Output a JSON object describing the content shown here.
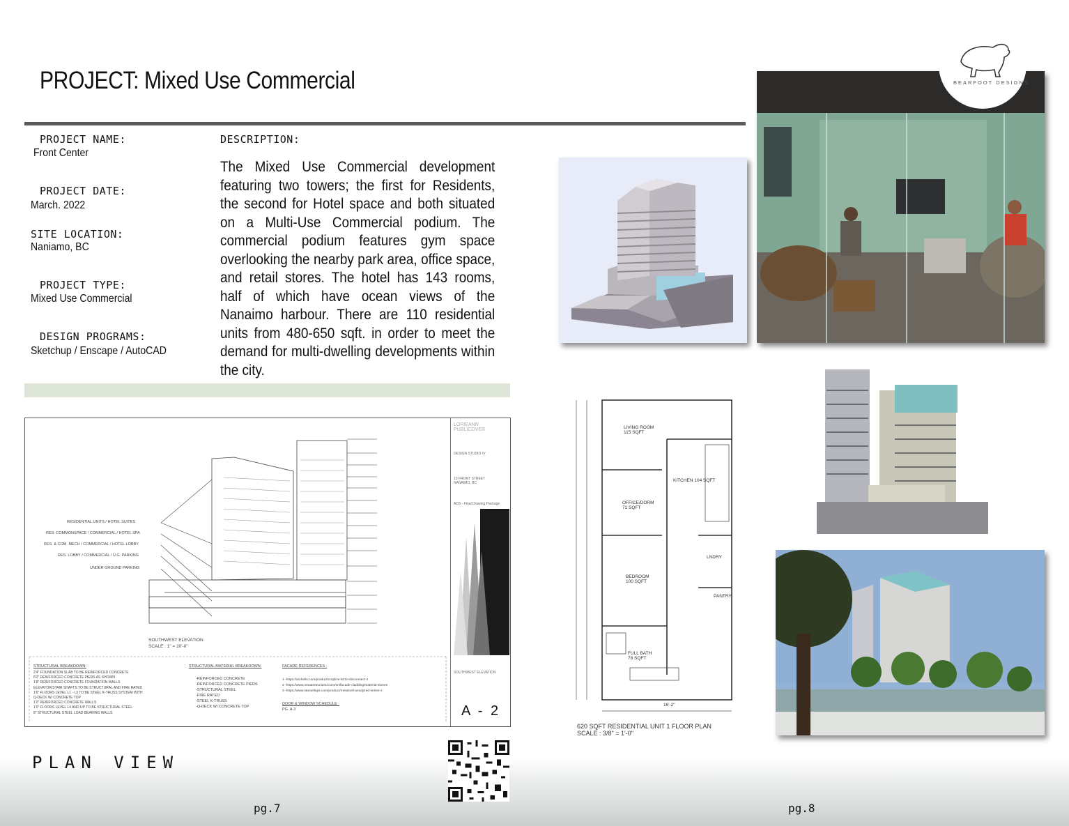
{
  "header": {
    "title": "PROJECT: Mixed Use Commercial"
  },
  "info": {
    "project_name_label": "PROJECT NAME:",
    "project_name": "Front Center",
    "project_date_label": "PROJECT DATE:",
    "project_date": "March. 2022",
    "site_location_label": "SITE LOCATION:",
    "site_location": "Naniamo, BC",
    "project_type_label": "PROJECT TYPE:",
    "project_type": "Mixed Use Commercial",
    "design_programs_label": "DESIGN PROGRAMS:",
    "design_programs": "Sketchup / Enscape / AutoCAD"
  },
  "description": {
    "label": "DESCRIPTION:",
    "text": "The Mixed Use Commercial development featuring two towers; the first for Residents, the second for Hotel space and both situated on a Multi-Use Commercial podium. The commercial podium features gym space overlooking the nearby park area, office space, and retail stores. The hotel has 143 rooms, half of which have ocean views of the Nanaimo harbour. There are 110 residential units from 480-650 sqft. in order to meet the demand for multi-dwelling developments within the city."
  },
  "logo": {
    "text": "BEARFOOT DESIGNS"
  },
  "drawing_sheet": {
    "sheet_id": "A - 2",
    "elevation_title": "SOUTHWEST ELEVATION",
    "elevation_scale": "SCALE : 1\" = 20'-0\"",
    "callouts": [
      "RESIDENTIAL UNITS / HOTEL SUITES",
      "RES. COMMONSPACE / COMMERCIAL / HOTEL SPA",
      "RES. & COM. MECH / COMMERCIAL / HOTEL LOBBY",
      "RES. LOBBY / COMMERCIAL / U.G. PARKING",
      "UNDER GROUND PARKING"
    ],
    "title_block": {
      "name": "LORIEANN PUBLICOVER",
      "project": "DESIGN STUDIO IV",
      "address": "10 FRONT STREET NANAIMO, BC",
      "package": "ADS - Final Drawing Package",
      "drawing": "SOUTHWEST ELEVATION"
    },
    "notes": {
      "structural_heading": "STRUCTURAL BREAKDOWN:",
      "structural": "2'4\" FOUNDATION SLAB TO BE REINFORCED CONCRETE\n8'2\" REINFORCED CONCRETE PIERS AS SHOWN\n1'8\" REINFORCED CONCRETE FOUNDATION WALLS\nELEVATOR/STAIR SHAFTS TO BE STRUCTURAL AND FIRE RATED\n1'6\" FLOORS LEVEL L1 - L3 TO BE STEEL K-TRUSS SYSTEM WITH\nQ-DECK W/ CONCRETE TOP\n1'0\" REINFORCED CONCRETE WALLS\n1'0\" FLOORS LEVEL L4 AND UP TO BE STRUCTURAL STEEL\n8\" STRUCTURAL STEEL LOAD BEARING WALLS",
      "material_heading": "STRUCTURAL MATERIAL BREAKDOWN:",
      "material": "-REINFORCED CONCRETE\n-REINFORCED CONCRETE PIERS\n-STRUCTURAL STEEL\n-FIRE RATED\n-STEEL K-TRUSS\n-Q-DECK W/ CONCRETE TOP",
      "facade_heading": "FACADE REFERENCES :",
      "facade": "1 -https://archello.com/product/corplive-6410-disconnect-2\n2 -https://www.omaarstructural.com/en/facade-cladding/material-stones\n3 -https://www.staroellaps.com/product/metalcell-anodyzed-series-4",
      "door_heading": "DOOR & WINDOW SCHEDULE :",
      "door": "PG. A-3"
    }
  },
  "floor_plan": {
    "title": "620 SQFT RESIDENTIAL UNIT 1 FLOOR PLAN",
    "scale": "SCALE : 3/8\" = 1'-0\"",
    "rooms": [
      {
        "name": "LIVING ROOM",
        "area": "115 SQFT"
      },
      {
        "name": "OFFICE/DORM",
        "area": "72 SQFT"
      },
      {
        "name": "BEDROOM",
        "area": "100 SQFT"
      },
      {
        "name": "FULL BATH",
        "area": "78 SQFT"
      },
      {
        "name": "KITCHEN",
        "area": "104 SQFT"
      },
      {
        "name": "LNDRY",
        "area": ""
      },
      {
        "name": "PANTRY",
        "area": ""
      }
    ],
    "overall_width": "16'-2\""
  },
  "footer": {
    "plan_view": "PLAN VIEW",
    "page_left": "pg.7",
    "page_right": "pg.8"
  }
}
